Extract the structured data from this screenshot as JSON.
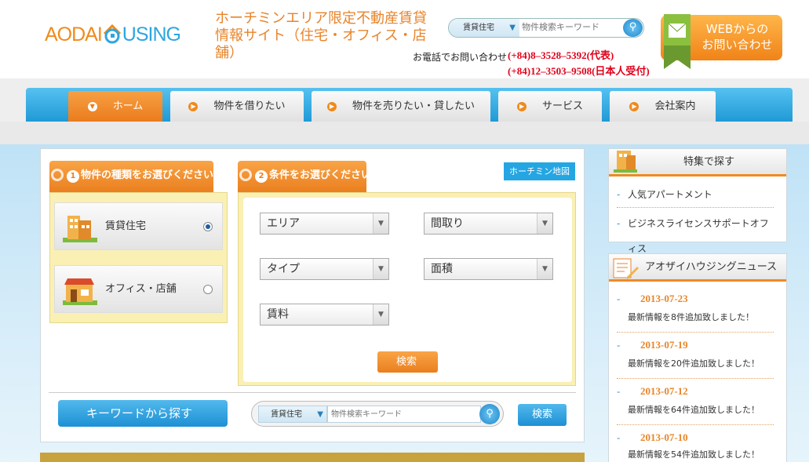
{
  "header": {
    "logo_text_a": "AODAI",
    "logo_text_b": "H",
    "logo_text_c": "USING",
    "tagline_line1": "ホーチミンエリア限定不動産賃貸",
    "tagline_line2": "情報サイト（住宅・オフィス・店舗）",
    "search_category": "賃貸住宅",
    "search_placeholder": "物件検索キーワード",
    "tel_note": "お電話でお問い合わせ",
    "tel1": "(+84)8–3528–5392(代表)",
    "tel2": "(+84)12–3503–9508(日本人受付)",
    "contact_line1": "WEBからの",
    "contact_line2": "お問い合わせ"
  },
  "nav": {
    "items": [
      {
        "label": "ホーム",
        "active": true
      },
      {
        "label": "物件を借りたい"
      },
      {
        "label": "物件を売りたい・貸したい"
      },
      {
        "label": "サービス"
      },
      {
        "label": "会社案内"
      }
    ]
  },
  "search_panel": {
    "step1_num": "1",
    "step1_label": "物件の種類をお選びください",
    "step2_num": "2",
    "step2_label": "条件をお選びください",
    "map_button": "ホーチミン地図",
    "types": [
      {
        "label": "賃貸住宅",
        "selected": true
      },
      {
        "label": "オフィス・店舗",
        "selected": false
      }
    ],
    "selects": {
      "area": "エリア",
      "layout": "間取り",
      "type": "タイプ",
      "size": "面積",
      "rent": "賃料"
    },
    "search_button": "検索",
    "keyword_label": "キーワードから探す",
    "keyword_category": "賃貸住宅",
    "keyword_placeholder": "物件検索キーワード",
    "keyword_button": "検索"
  },
  "sidebar": {
    "feature_title": "特集で探す",
    "feature_links": [
      "人気アパートメント",
      "ビジネスライセンスサポートオフィス"
    ],
    "news_title": "アオザイハウジングニュース",
    "news": [
      {
        "date": "2013-07-23",
        "text": "最新情報を8件追加致しました！"
      },
      {
        "date": "2013-07-19",
        "text": "最新情報を20件追加致しました！"
      },
      {
        "date": "2013-07-12",
        "text": "最新情報を64件追加致しました！"
      },
      {
        "date": "2013-07-10",
        "text": "最新情報を54件追加致しました！"
      }
    ]
  },
  "colors": {
    "accent_orange": "#f08a1b",
    "accent_blue": "#2ea6df",
    "phone_red": "#e0001a"
  }
}
